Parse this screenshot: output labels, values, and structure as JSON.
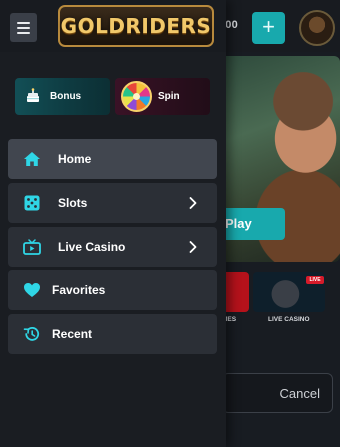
{
  "background": {
    "balance": ".00",
    "deposit_glyph": "+",
    "hero_play_label": "Play",
    "live_badge": "LIVE",
    "tile_caption_games": "MES",
    "tile_caption_live": "LIVE CASINO",
    "cancel_label": "Cancel"
  },
  "header": {
    "logo_text": "GOLDRIDERS",
    "menu_icon": "hamburger-icon"
  },
  "promos": [
    {
      "label": "Bonus",
      "icon": "gift-cake-icon",
      "accent": "#124f56"
    },
    {
      "label": "Spin",
      "icon": "wheel-of-fortune-icon",
      "accent": "#3a1226"
    }
  ],
  "nav": {
    "items": [
      {
        "label": "Home",
        "icon": "home-icon",
        "active": true,
        "has_submenu": false
      },
      {
        "label": "Slots",
        "icon": "dice-icon",
        "active": false,
        "has_submenu": true
      },
      {
        "label": "Live Casino",
        "icon": "tv-icon",
        "active": false,
        "has_submenu": true
      },
      {
        "label": "Favorites",
        "icon": "heart-icon",
        "active": false,
        "has_submenu": false
      },
      {
        "label": "Recent",
        "icon": "history-icon",
        "active": false,
        "has_submenu": false
      }
    ]
  },
  "colors": {
    "accent_teal": "#18a9ad",
    "icon_cyan": "#2fd6e6",
    "drawer_bg": "#1a1d22",
    "item_bg": "#2b2f36",
    "item_active_bg": "#41464f"
  }
}
